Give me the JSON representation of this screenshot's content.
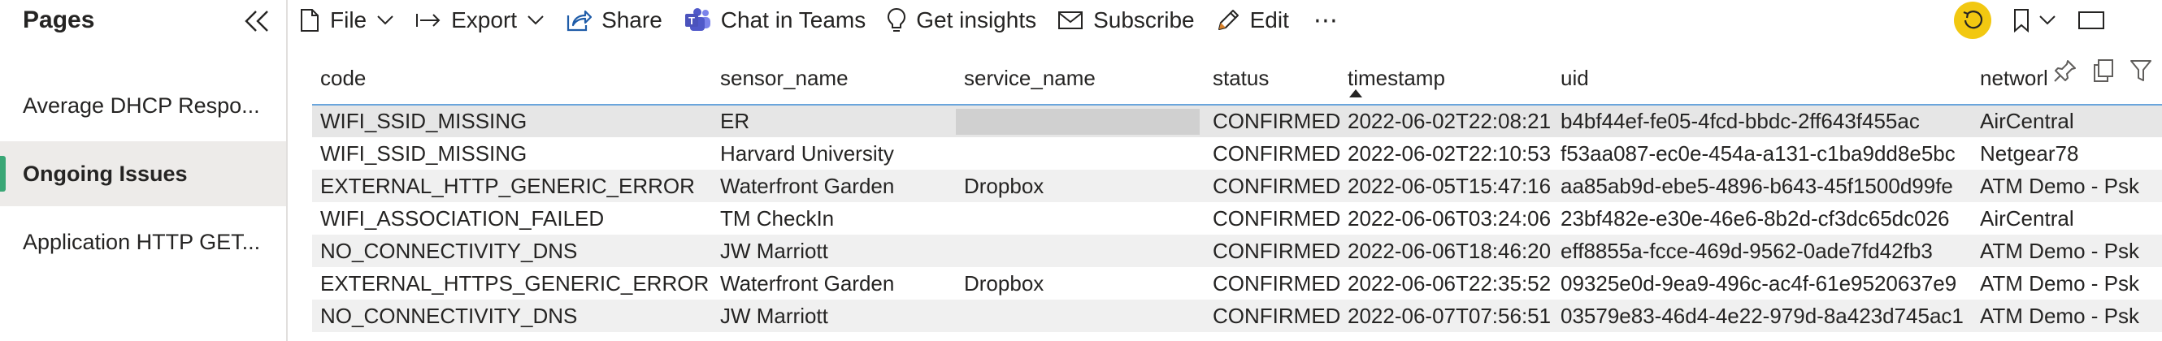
{
  "pages_pane": {
    "title": "Pages",
    "items": [
      {
        "label": "Average DHCP Respo...",
        "active": false
      },
      {
        "label": "Ongoing Issues",
        "active": true
      },
      {
        "label": "Application HTTP GET...",
        "active": false
      }
    ]
  },
  "toolbar": {
    "file": "File",
    "export": "Export",
    "share": "Share",
    "teams": "Chat in Teams",
    "insights": "Get insights",
    "subscribe": "Subscribe",
    "edit": "Edit",
    "more": "⋯"
  },
  "colors": {
    "accent_green": "#3aa776",
    "reset_yellow": "#f2c811",
    "header_rule": "#6aa5dc"
  },
  "table": {
    "columns": [
      "code",
      "sensor_name",
      "service_name",
      "status",
      "timestamp",
      "uid",
      "network"
    ],
    "sorted_column": "timestamp",
    "rows": [
      [
        "WIFI_SSID_MISSING",
        "ER",
        "",
        "CONFIRMED",
        "2022-06-02T22:08:21",
        "b4bf44ef-fe05-4fcd-bbdc-2ff643f455ac",
        "AirCentral"
      ],
      [
        "WIFI_SSID_MISSING",
        "Harvard University",
        "",
        "CONFIRMED",
        "2022-06-02T22:10:53",
        "f53aa087-ec0e-454a-a131-c1ba9dd8e5bc",
        "Netgear78"
      ],
      [
        "EXTERNAL_HTTP_GENERIC_ERROR",
        "Waterfront Garden",
        "Dropbox",
        "CONFIRMED",
        "2022-06-05T15:47:16",
        "aa85ab9d-ebe5-4896-b643-45f1500d99fe",
        "ATM Demo - Psk"
      ],
      [
        "WIFI_ASSOCIATION_FAILED",
        "TM CheckIn",
        "",
        "CONFIRMED",
        "2022-06-06T03:24:06",
        "23bf482e-e30e-46e6-8b2d-cf3dc65dc026",
        "AirCentral"
      ],
      [
        "NO_CONNECTIVITY_DNS",
        "JW Marriott",
        "",
        "CONFIRMED",
        "2022-06-06T18:46:20",
        "eff8855a-fcce-469d-9562-0ade7fd42fb3",
        "ATM Demo - Psk"
      ],
      [
        "EXTERNAL_HTTPS_GENERIC_ERROR",
        "Waterfront Garden",
        "Dropbox",
        "CONFIRMED",
        "2022-06-06T22:35:52",
        "09325e0d-9ea9-496c-ac4f-61e9520637e9",
        "ATM Demo - Psk"
      ],
      [
        "NO_CONNECTIVITY_DNS",
        "JW Marriott",
        "",
        "CONFIRMED",
        "2022-06-07T07:56:51",
        "03579e83-46d4-4e22-979d-8a423d745ac1",
        "ATM Demo - Psk"
      ]
    ]
  }
}
